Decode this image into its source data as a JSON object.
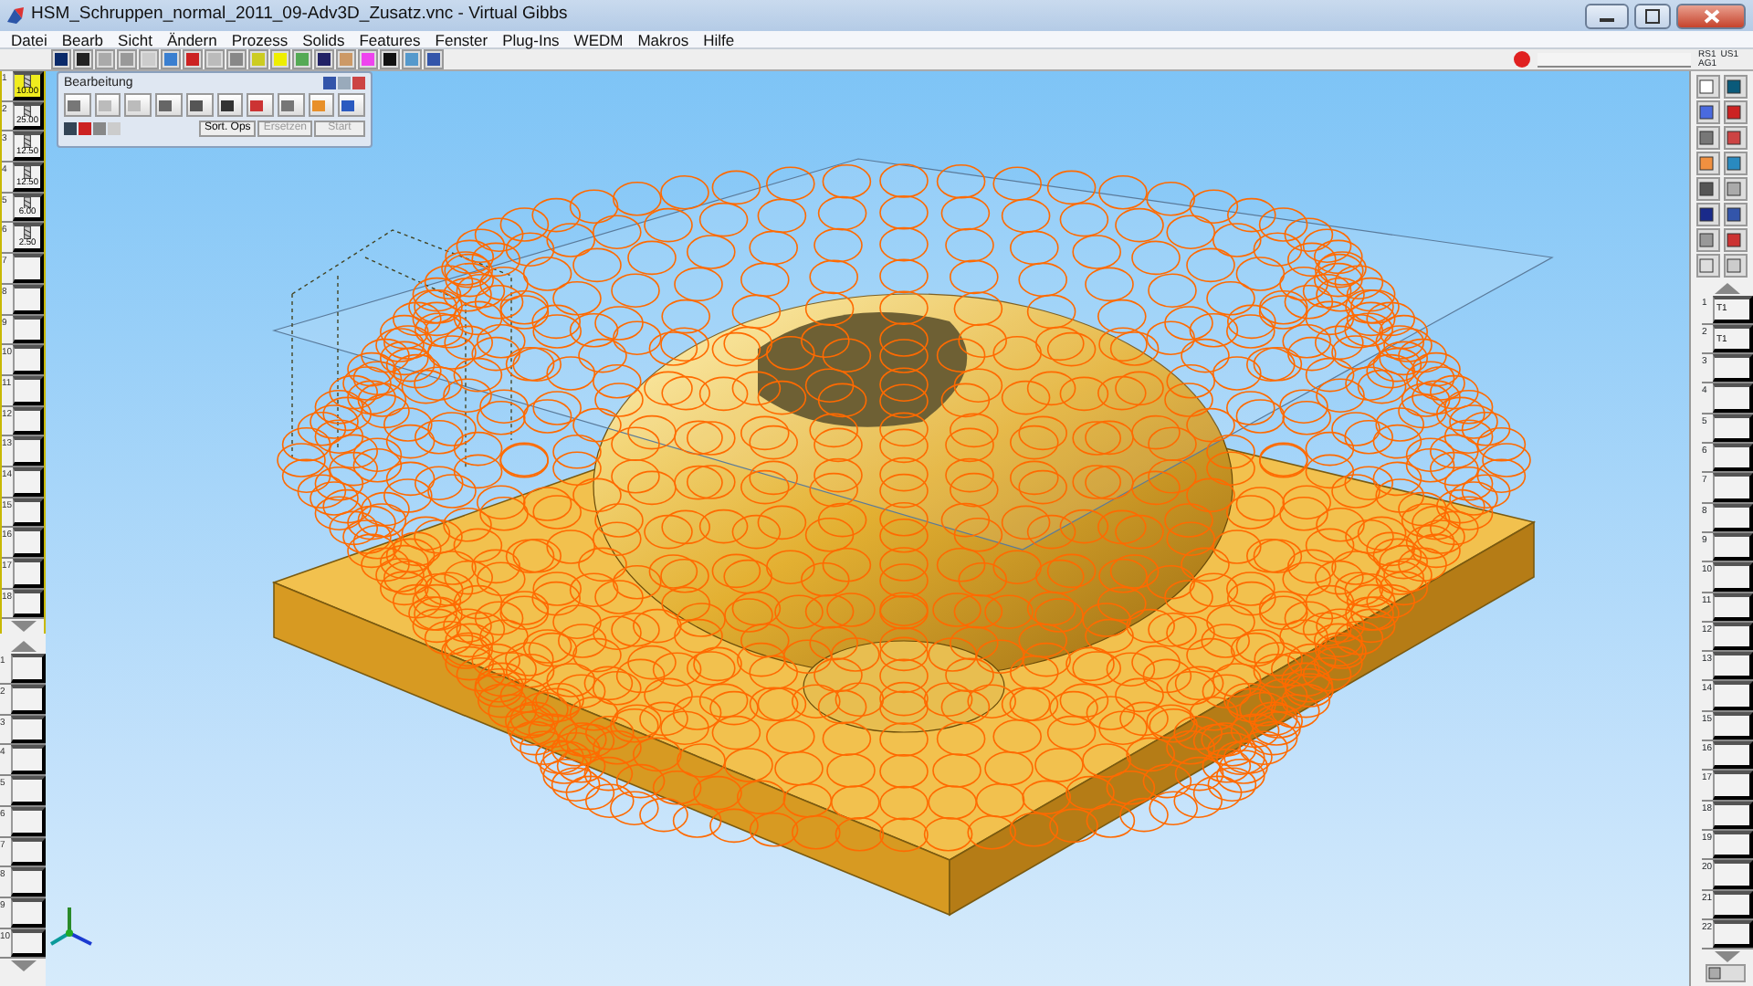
{
  "window": {
    "title": "HSM_Schruppen_normal_2011_09-Adv3D_Zusatz.vnc - Virtual Gibbs"
  },
  "menu": [
    "Datei",
    "Bearb",
    "Sicht",
    "Ändern",
    "Prozess",
    "Solids",
    "Features",
    "Fenster",
    "Plug-Ins",
    "WEDM",
    "Makros",
    "Hilfe"
  ],
  "status_labels": [
    "RS1",
    "US1",
    "AG1"
  ],
  "operations_panel": {
    "title": "Bearbeitung",
    "buttons": [
      {
        "label": "Sort. Ops",
        "disabled": false
      },
      {
        "label": "Ersetzen",
        "disabled": true
      },
      {
        "label": "Start",
        "disabled": true
      }
    ]
  },
  "tool_list": {
    "slots": [
      {
        "number": "1",
        "kind": "tool",
        "value": "10.00",
        "selected": true
      },
      {
        "number": "2",
        "kind": "tool",
        "value": "25.00",
        "selected": false
      },
      {
        "number": "3",
        "kind": "tool",
        "value": "12.50",
        "selected": false
      },
      {
        "number": "4",
        "kind": "tool",
        "value": "12.50",
        "selected": false
      },
      {
        "number": "5",
        "kind": "tool",
        "value": "6.00",
        "selected": false
      },
      {
        "number": "6",
        "kind": "tool",
        "value": "2.50",
        "selected": false
      },
      {
        "number": "7",
        "kind": "empty",
        "selected": false
      },
      {
        "number": "8",
        "kind": "empty",
        "selected": false
      },
      {
        "number": "9",
        "kind": "empty",
        "selected": false
      },
      {
        "number": "10",
        "kind": "empty",
        "selected": false
      },
      {
        "number": "11",
        "kind": "empty",
        "selected": false
      },
      {
        "number": "12",
        "kind": "empty",
        "selected": false
      },
      {
        "number": "13",
        "kind": "empty",
        "selected": false
      },
      {
        "number": "14",
        "kind": "empty",
        "selected": false
      },
      {
        "number": "15",
        "kind": "empty",
        "selected": false
      },
      {
        "number": "16",
        "kind": "empty",
        "selected": false
      },
      {
        "number": "17",
        "kind": "empty",
        "selected": false
      },
      {
        "number": "18",
        "kind": "empty",
        "selected": false
      }
    ]
  },
  "material_list": {
    "slots": [
      {
        "number": "1"
      },
      {
        "number": "2"
      },
      {
        "number": "3"
      },
      {
        "number": "4"
      },
      {
        "number": "5"
      },
      {
        "number": "6"
      },
      {
        "number": "7"
      },
      {
        "number": "8"
      },
      {
        "number": "9"
      },
      {
        "number": "10"
      }
    ]
  },
  "process_list": {
    "slots": [
      {
        "number": "1",
        "kind": "process",
        "label": "T1"
      },
      {
        "number": "2",
        "kind": "process",
        "label": "T1"
      },
      {
        "number": "3",
        "kind": "empty"
      },
      {
        "number": "4",
        "kind": "empty"
      },
      {
        "number": "5",
        "kind": "empty"
      },
      {
        "number": "6",
        "kind": "empty"
      },
      {
        "number": "7",
        "kind": "empty"
      },
      {
        "number": "8",
        "kind": "empty"
      },
      {
        "number": "9",
        "kind": "empty"
      },
      {
        "number": "10",
        "kind": "empty"
      },
      {
        "number": "11",
        "kind": "empty"
      },
      {
        "number": "12",
        "kind": "empty"
      },
      {
        "number": "13",
        "kind": "empty"
      },
      {
        "number": "14",
        "kind": "empty"
      },
      {
        "number": "15",
        "kind": "empty"
      },
      {
        "number": "16",
        "kind": "empty"
      },
      {
        "number": "17",
        "kind": "empty"
      },
      {
        "number": "18",
        "kind": "empty"
      },
      {
        "number": "19",
        "kind": "empty"
      },
      {
        "number": "20",
        "kind": "empty"
      },
      {
        "number": "21",
        "kind": "empty"
      },
      {
        "number": "22",
        "kind": "empty"
      }
    ]
  }
}
